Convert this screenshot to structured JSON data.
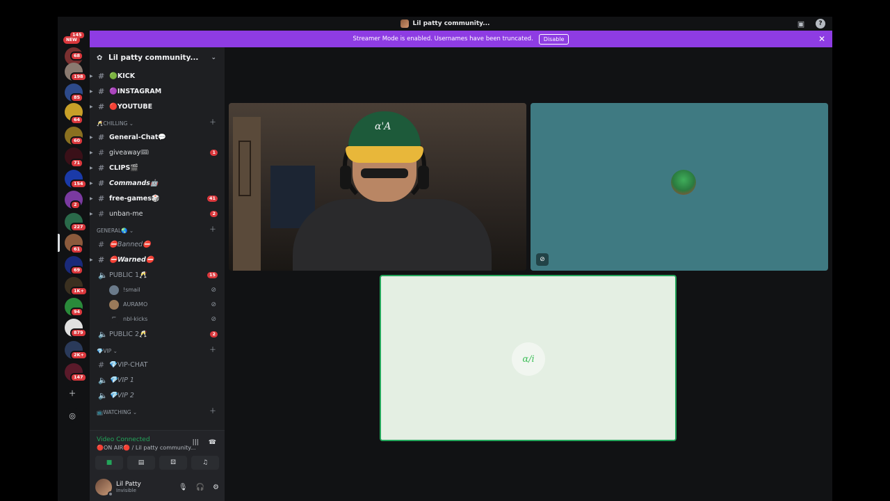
{
  "window": {
    "title": "Lil patty community..."
  },
  "banner": {
    "text": "Streamer Mode is enabled. Usernames have been truncated.",
    "button": "Disable"
  },
  "rail": {
    "top_count": "145",
    "new_label": "NEW",
    "badges": [
      "68",
      "198",
      "85",
      "64",
      "60",
      "71",
      "154",
      "2",
      "227",
      "61",
      "69",
      "1K+",
      "94",
      "879",
      "2K+",
      "147"
    ]
  },
  "server": {
    "name": "Lil patty community..."
  },
  "channels": [
    {
      "type": "text",
      "name": "🟢KICK",
      "unread": true
    },
    {
      "type": "text",
      "name": "🟣INSTAGRAM",
      "unread": true
    },
    {
      "type": "text",
      "name": "🔴YOUTUBE",
      "unread": true
    }
  ],
  "cat_chilling": {
    "name": "🥂CHILLING"
  },
  "chilling_channels": [
    {
      "name": "General-Chat💬",
      "unread": true,
      "mention": ""
    },
    {
      "name": "giveaway🎟",
      "unread": false,
      "mention": "1"
    },
    {
      "name": "CLIPS🎬",
      "unread": true,
      "mention": ""
    },
    {
      "name": "Commands🤖",
      "unread": true,
      "mention": "",
      "italic": true
    },
    {
      "name": "free-games🎲",
      "unread": true,
      "mention": "41"
    },
    {
      "name": "unban-me",
      "unread": false,
      "mention": "2"
    }
  ],
  "cat_general": {
    "name": "GENERAL🌏"
  },
  "general_channels": [
    {
      "name": "⛔Banned⛔",
      "mention": ""
    },
    {
      "name": "⛔Warned⛔",
      "mention": ""
    }
  ],
  "voice1": {
    "name": "PUBLIC 1🥂",
    "mention": "15"
  },
  "voice_users": [
    "!smail",
    "AURAMO",
    "nbl-kicks"
  ],
  "voice2": {
    "name": "PUBLIC 2🥂",
    "mention": "2"
  },
  "cat_vip": {
    "name": "💎VIP"
  },
  "vip_channels": [
    "💎VIP-CHAT",
    "💎VIP 1",
    "💎VIP 2"
  ],
  "cat_watching": {
    "name": "📺watching"
  },
  "voice_panel": {
    "status": "Video Connected",
    "channel": "🔴ON AIR🔴 / Lil patty community..."
  },
  "user": {
    "name": "Lil Patty",
    "status": "Invisible"
  },
  "colors": {
    "accent": "#8e3ce3",
    "connected": "#23a55a",
    "mention": "#da373c",
    "teal_tile": "#3f7a82",
    "green_tile": "#e4efe3"
  },
  "stage": {
    "green_tile_logo": "ɑ/i"
  }
}
